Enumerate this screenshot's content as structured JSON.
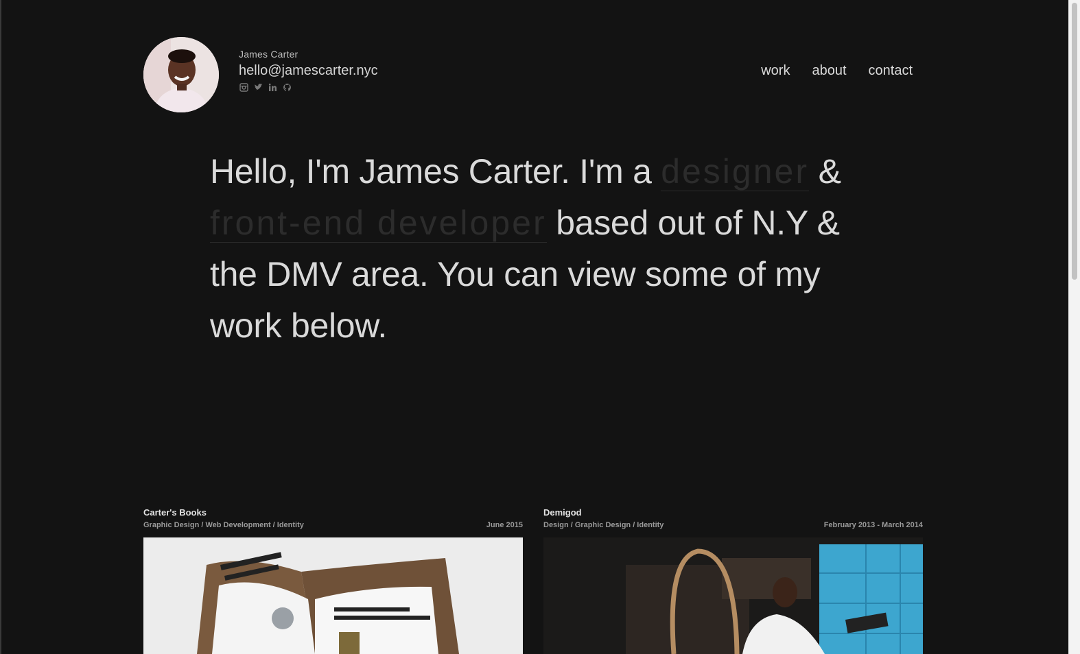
{
  "profile": {
    "name": "James Carter",
    "email": "hello@jamescarter.nyc",
    "socials": [
      "instagram-icon",
      "twitter-icon",
      "linkedin-icon",
      "github-icon"
    ]
  },
  "nav": {
    "work": "work",
    "about": "about",
    "contact": "contact"
  },
  "hero": {
    "part1": "Hello, I'm James Carter. I'm a ",
    "role1": "designer",
    "part2": " & ",
    "role2": "front-end developer",
    "part3": " based out of N.Y & the DMV area. You can view some of my work below."
  },
  "projects": [
    {
      "title": "Carter's Books",
      "tags": "Graphic Design / Web Development / Identity",
      "date": "June 2015"
    },
    {
      "title": "Demigod",
      "tags": "Design / Graphic Design / Identity",
      "date": "February 2013 - March 2014"
    }
  ],
  "colors": {
    "background": "#131313",
    "text": "#dadada",
    "faded": "#2c2c2c"
  }
}
